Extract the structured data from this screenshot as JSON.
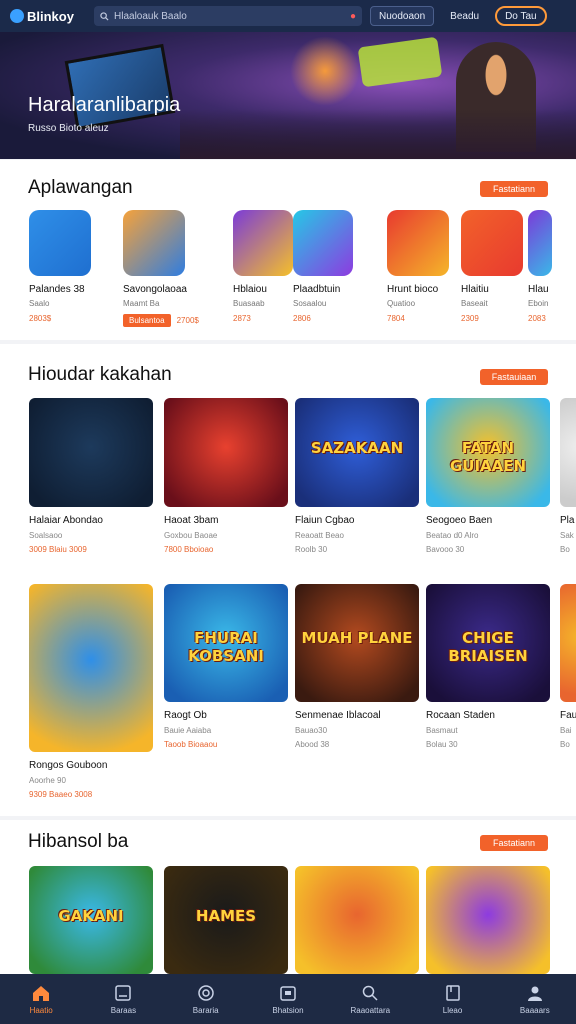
{
  "topbar": {
    "logo_text": "Blinkoy",
    "search_placeholder": "Hlaaloauk Baalo",
    "btn1": "Nuodoaon",
    "btn2": "Beadu",
    "btn3": "Do Tau"
  },
  "hero": {
    "title": "Haralaranlibarpia",
    "subtitle": "Russo Bioto aleuz"
  },
  "section1": {
    "title": "Aplawangan",
    "see_all": "Fastatiann",
    "apps": [
      {
        "name": "Palandes 38",
        "meta": "Saalo",
        "price": "2803$",
        "colors": [
          "#2f8fe8",
          "#1f6fd0"
        ]
      },
      {
        "name": "Savongolaoaa",
        "meta": "Maamt Ba",
        "price": "2700$",
        "pill": "Bulsantoa",
        "colors": [
          "#f6a23a",
          "#2f7de0"
        ]
      },
      {
        "name": "Hblaiou",
        "meta": "Buasaab",
        "price": "2873",
        "colors": [
          "#7b3bd8",
          "#f5c02a"
        ]
      },
      {
        "name": "Plaadbtuin",
        "meta": "Sosaalou",
        "price": "2806",
        "colors": [
          "#25c8e6",
          "#8d3be0"
        ]
      },
      {
        "name": "Hrunt bioco",
        "meta": "Quatioo",
        "price": "7804",
        "colors": [
          "#e83a2f",
          "#f5b52a"
        ]
      },
      {
        "name": "Hlaitiu",
        "meta": "Baseait",
        "price": "2309",
        "colors": [
          "#f2622a",
          "#e83a2f"
        ]
      },
      {
        "name": "Hlau",
        "meta": "Eboin",
        "price": "2083",
        "colors": [
          "#7b3bd8",
          "#3ab8e8"
        ]
      }
    ]
  },
  "section2": {
    "title": "Hioudar kakahan",
    "see_all": "Fastauiaan",
    "row1": [
      {
        "name": "Halaiar Abondao",
        "meta": "Soalsaoo",
        "price": "3009 Blaiu 3009",
        "thumb_text": "",
        "colors": [
          "#1d3a5c",
          "#0f1e33"
        ]
      },
      {
        "name": "Haoat 3bam",
        "meta": "Goxbou Baoae",
        "price": "7800 Bboioao",
        "thumb_text": "",
        "colors": [
          "#e8412f",
          "#6a0f1a"
        ]
      },
      {
        "name": "Flaiun Cgbao",
        "meta": "Reaoatt Beao",
        "price": "Roolb 30",
        "thumb_text": "SAZAKAAN",
        "colors": [
          "#2f5ed8",
          "#1a2f7a"
        ]
      },
      {
        "name": "Seogoeo Baen",
        "meta": "Beatao d0 Alro",
        "price": "Bavooo 30",
        "thumb_text": "FATAN GUIAAEN",
        "colors": [
          "#f5c02a",
          "#3ab8e8"
        ]
      },
      {
        "name": "Pla",
        "meta": "Sak",
        "price": "Bo",
        "thumb_text": "",
        "colors": [
          "#eeeeee",
          "#cccccc"
        ]
      }
    ],
    "row2": [
      {
        "name": "Rongos Gouboon",
        "meta": "Aoorhe 90",
        "price": "9309 Baaeo 3008",
        "thumb_text": "",
        "colors": [
          "#2f8fe8",
          "#f5b52a"
        ]
      },
      {
        "name": "Raogt Ob",
        "meta": "Bauie Aaiaba",
        "price": "Taoob Bioaaou",
        "thumb_text": "FHURAI KOBSANI",
        "colors": [
          "#3ab8e8",
          "#1a5fb3"
        ]
      },
      {
        "name": "Senmenae Iblacoal",
        "meta": "Bauao30",
        "price": "Abood 38",
        "thumb_text": "MUAH PLANE",
        "colors": [
          "#b34a1f",
          "#3a1a10"
        ]
      },
      {
        "name": "Rocaan Staden",
        "meta": "Basmaut",
        "price": "Bolau 30",
        "thumb_text": "CHIGE BRIAISEN",
        "colors": [
          "#3b2a8a",
          "#1a0f3a"
        ]
      },
      {
        "name": "Fau",
        "meta": "Bai",
        "price": "Bo",
        "thumb_text": "",
        "colors": [
          "#f5b52a",
          "#e8652f"
        ]
      }
    ]
  },
  "section3": {
    "title": "Hibansol ba",
    "see_all": "Fastatiann",
    "cards": [
      {
        "thumb_text": "GAKANI",
        "colors": [
          "#3ab8e8",
          "#2f8a3a"
        ]
      },
      {
        "thumb_text": "HAMES",
        "colors": [
          "#1a1a1a",
          "#3a2a10"
        ]
      },
      {
        "thumb_text": "",
        "colors": [
          "#e8652f",
          "#f5c02a"
        ]
      },
      {
        "thumb_text": "",
        "colors": [
          "#8d3be0",
          "#f5c02a"
        ]
      }
    ]
  },
  "bottomnav": [
    {
      "label": "Haatio",
      "icon": "home-icon",
      "active": true
    },
    {
      "label": "Baraas",
      "icon": "book-icon"
    },
    {
      "label": "Bararia",
      "icon": "compass-icon"
    },
    {
      "label": "Bhatsion",
      "icon": "bag-icon"
    },
    {
      "label": "Raaoattara",
      "icon": "search-icon"
    },
    {
      "label": "Lleao",
      "icon": "library-icon"
    },
    {
      "label": "Baaaars",
      "icon": "profile-icon"
    }
  ]
}
